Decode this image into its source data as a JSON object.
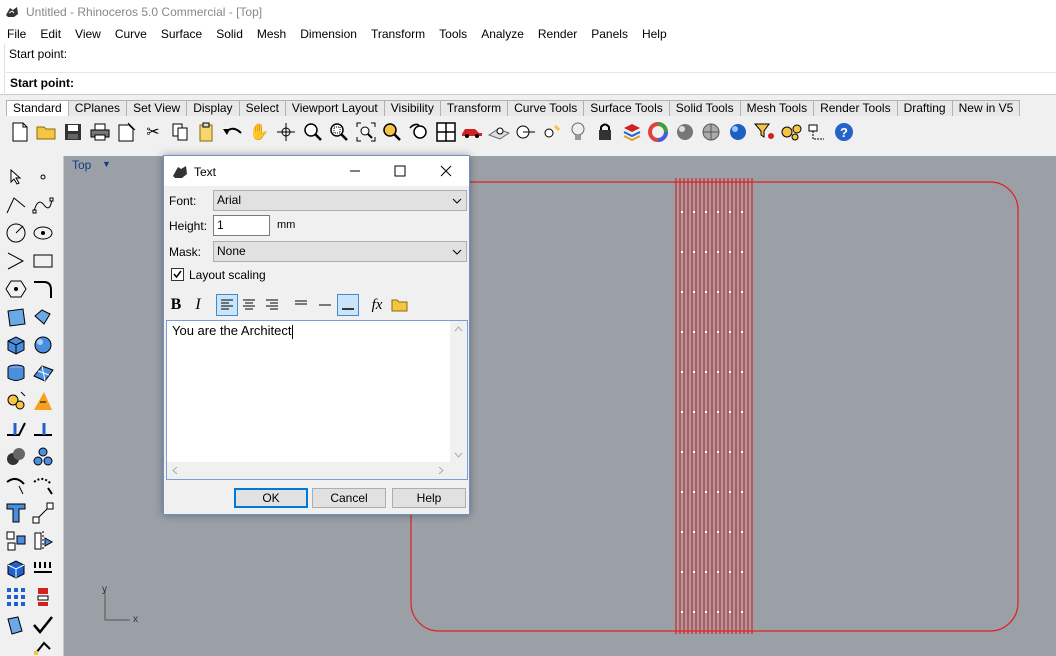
{
  "window": {
    "title": "Untitled - Rhinoceros 5.0 Commercial - [Top]",
    "icon": "rhino-icon"
  },
  "menu": [
    "File",
    "Edit",
    "View",
    "Curve",
    "Surface",
    "Solid",
    "Mesh",
    "Dimension",
    "Transform",
    "Tools",
    "Analyze",
    "Render",
    "Panels",
    "Help"
  ],
  "command": {
    "history": "Start point:",
    "prompt": "Start point:"
  },
  "toolbar_tabs": [
    "Standard",
    "CPlanes",
    "Set View",
    "Display",
    "Select",
    "Viewport Layout",
    "Visibility",
    "Transform",
    "Curve Tools",
    "Surface Tools",
    "Solid Tools",
    "Mesh Tools",
    "Render Tools",
    "Drafting",
    "New in V5"
  ],
  "active_tab": "Standard",
  "viewport": {
    "name": "Top",
    "axis_x": "x",
    "axis_y": "y"
  },
  "dialog": {
    "title": "Text",
    "font_label": "Font:",
    "font_value": "Arial",
    "height_label": "Height:",
    "height_value": "1",
    "height_unit": "mm",
    "mask_label": "Mask:",
    "mask_value": "None",
    "layout_scaling_label": "Layout scaling",
    "layout_scaling_checked": true,
    "text": "You are the Architect",
    "buttons": {
      "ok": "OK",
      "cancel": "Cancel",
      "help": "Help"
    }
  },
  "colors": {
    "viewport_bg": "#9aa0a6",
    "curve": "#e02020",
    "accent": "#0078d7",
    "viewport_label": "#143c80"
  }
}
